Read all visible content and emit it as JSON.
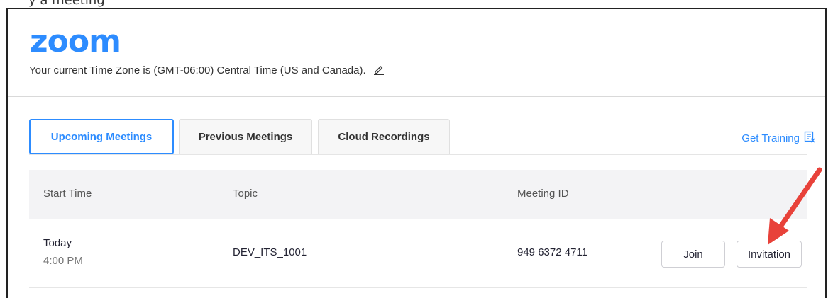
{
  "top_snippet": "y a meeting",
  "app": {
    "logo": "zoom",
    "timezone_text": "Your current Time Zone is (GMT-06:00) Central Time (US and Canada).",
    "edit_icon": "pencil-icon"
  },
  "tabs": [
    {
      "label": "Upcoming Meetings",
      "active": true
    },
    {
      "label": "Previous Meetings",
      "active": false
    },
    {
      "label": "Cloud Recordings",
      "active": false
    }
  ],
  "training": {
    "label": "Get Training",
    "icon": "training-icon"
  },
  "table": {
    "headers": [
      "Start Time",
      "Topic",
      "Meeting ID"
    ],
    "rows": [
      {
        "date": "Today",
        "time": "4:00 PM",
        "topic": "DEV_ITS_1001",
        "meeting_id": "949 6372 4711",
        "join_label": "Join",
        "invitation_label": "Invitation"
      }
    ]
  },
  "colors": {
    "brand": "#2D8CFF",
    "annotation_arrow": "#E8423A"
  }
}
